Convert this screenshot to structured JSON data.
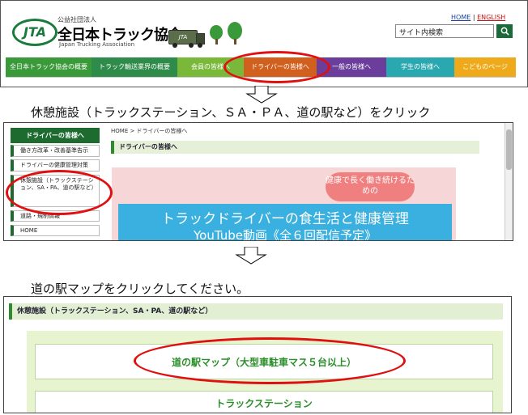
{
  "panel1": {
    "logo_text": "JTA",
    "org_type": "公益社団法人",
    "org_name": "全日本トラック協会",
    "org_name_en": "Japan Trucking Association",
    "truck_label": "JTA",
    "links": {
      "home": "HOME",
      "separator": "|",
      "english": "ENGLISH"
    },
    "search_value": "サイト内検索",
    "search_icon": "magnifier-icon",
    "nav": [
      {
        "label": "全日本トラック協会の概要",
        "color": "#3a9a3a"
      },
      {
        "label": "トラック輸送業界の概要",
        "color": "#2f8b4a"
      },
      {
        "label": "会員の皆様へ",
        "color": "#7ab83a"
      },
      {
        "label": "ドライバーの皆様へ",
        "color": "#d1601e"
      },
      {
        "label": "一般の皆様へ",
        "color": "#6a3e9a"
      },
      {
        "label": "学生の皆様へ",
        "color": "#2aa8b0"
      },
      {
        "label": "こどものページ",
        "color": "#eeaa1a"
      }
    ]
  },
  "instruction1": "休憩施設（トラックステーション、ＳＡ・ＰＡ、道の駅など）をクリック",
  "panel2": {
    "sidebar_title": "ドライバーの皆様へ",
    "sidebar_items": [
      "働き方改革・改善基準告示",
      "ドライバーの健康管理対策",
      "休憩施設（トラックステーション、SA・PA、道の駅など）",
      "道路・規制情報",
      "HOME"
    ],
    "breadcrumb": "HOME > ドライバーの皆様へ",
    "section_title": "ドライバーの皆様へ",
    "bubble_text": "健康で長く働き続けるための",
    "banner_title": "トラックドライバーの食生活と健康管理",
    "banner_subtitle": "YouTube動画《全６回配信予定》"
  },
  "instruction2": "道の駅マップをクリックしてください。",
  "panel3": {
    "section_title": "休憩施設（トラックステーション、SA・PA、道の駅など）",
    "map_button": "道の駅マップ（大型車駐車マス５台以上）",
    "ts_button": "トラックステーション"
  },
  "colors": {
    "highlight": "#e01010",
    "brand_green": "#1b7a3e"
  }
}
